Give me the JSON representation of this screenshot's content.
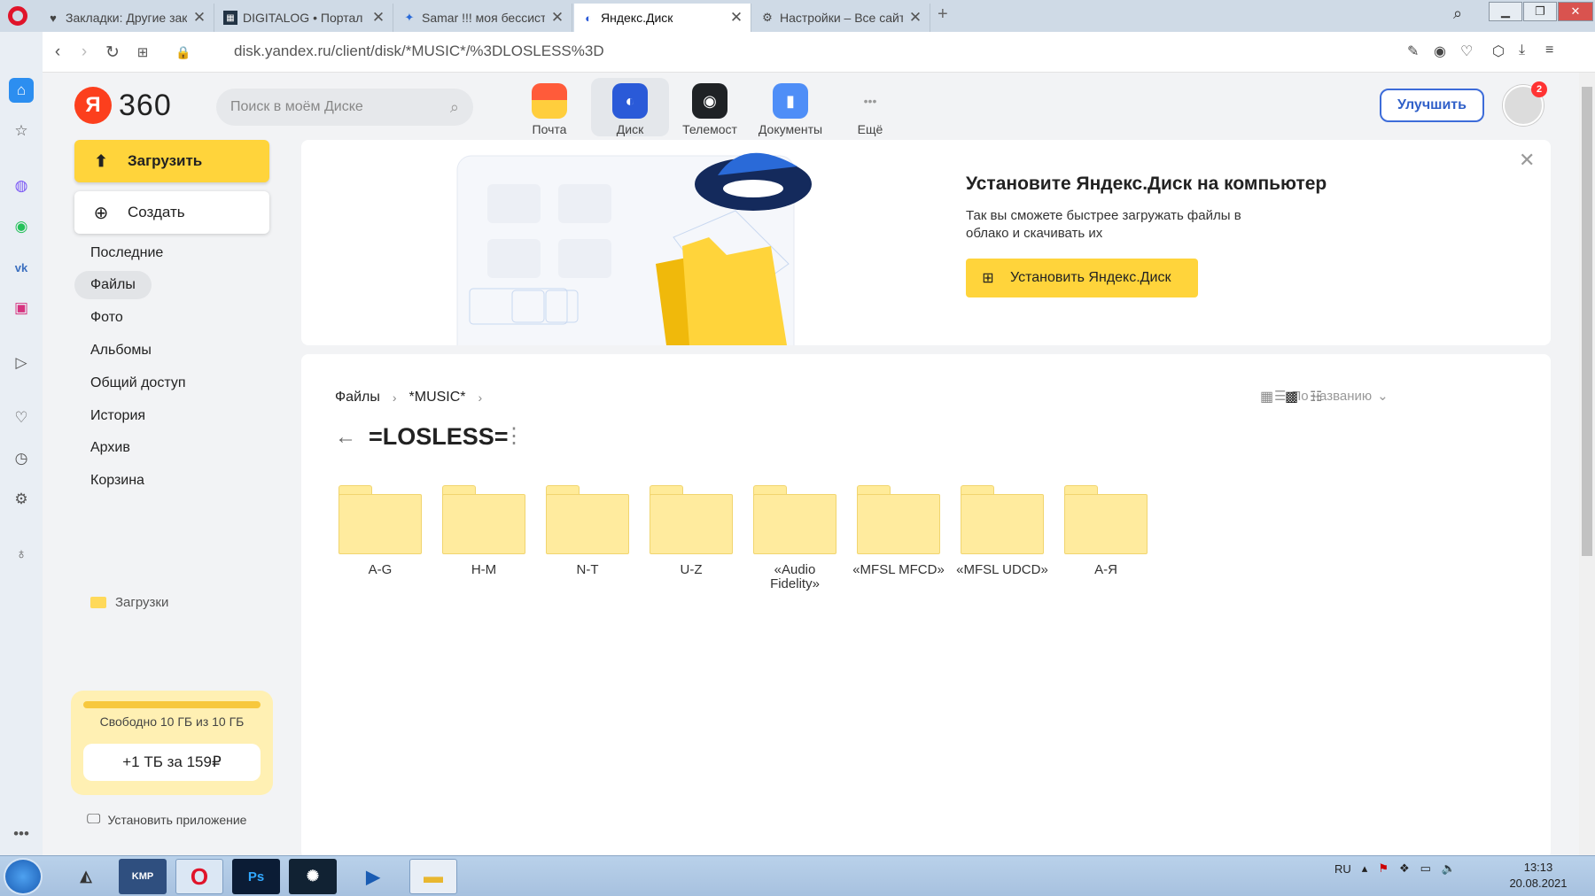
{
  "browser": {
    "tabs": [
      {
        "icon": "heart-icon",
        "title": "Закладки: Другие закладк",
        "active": false
      },
      {
        "icon": "digitalog-icon",
        "title": "DIGITALOG • Портал",
        "active": false
      },
      {
        "icon": "waveform-icon",
        "title": "Samar !!! моя бессистемн",
        "active": false
      },
      {
        "icon": "yandex-disk-icon",
        "title": "Яндекс.Диск",
        "active": true
      },
      {
        "icon": "gear-icon",
        "title": "Настройки – Все сайты",
        "active": false
      }
    ],
    "new_tab": "+",
    "url": "disk.yandex.ru/client/disk/*MUSIC*/%3DLOSLESS%3D"
  },
  "header": {
    "logo_letter": "Я",
    "logo_text": "360",
    "search_placeholder": "Поиск в моём Диске",
    "services": [
      {
        "name": "mail",
        "label": "Почта",
        "color": "#ffce3d"
      },
      {
        "name": "disk",
        "label": "Диск",
        "color": "#2a5ad8",
        "active": true
      },
      {
        "name": "telemost",
        "label": "Телемост",
        "color": "#1f2225"
      },
      {
        "name": "documents",
        "label": "Документы",
        "color": "#4f8ef7"
      },
      {
        "name": "more",
        "label": "Ещё"
      }
    ],
    "upgrade_label": "Улучшить",
    "notification_count": "2"
  },
  "sidebar": {
    "upload_label": "Загрузить",
    "create_label": "Создать",
    "nav": [
      {
        "label": "Последние",
        "active": false
      },
      {
        "label": "Файлы",
        "active": true
      },
      {
        "label": "Фото",
        "active": false
      },
      {
        "label": "Альбомы",
        "active": false
      },
      {
        "label": "Общий доступ",
        "active": false
      },
      {
        "label": "История",
        "active": false
      },
      {
        "label": "Архив",
        "active": false
      },
      {
        "label": "Корзина",
        "active": false
      }
    ],
    "downloads_label": "Загрузки",
    "storage_text": "Свободно 10 ГБ из 10 ГБ",
    "storage_used_fraction": 0.0,
    "storage_button": "+1 ТБ за 159₽",
    "install_app": "Установить приложение"
  },
  "promo": {
    "title": "Установите Яндекс.Диск на компьютер",
    "text": "Так вы сможете быстрее загружать файлы в облако и скачивать их",
    "button": "Установить Яндекс.Диск"
  },
  "files": {
    "breadcrumbs": [
      "Файлы",
      "*MUSIC*"
    ],
    "title": "=LOSLESS=",
    "sort_label": "По названию",
    "folders": [
      "A-G",
      "H-M",
      "N-T",
      "U-Z",
      "«Audio Fidelity»",
      "«MFSL MFCD»",
      "«MFSL UDCD»",
      "А-Я"
    ]
  },
  "taskbar": {
    "apps": [
      {
        "name": "taskbar-app-fox",
        "label": ""
      },
      {
        "name": "taskbar-app-kmplayer",
        "label": "KMP"
      },
      {
        "name": "taskbar-app-opera",
        "label": "O"
      },
      {
        "name": "taskbar-app-photoshop",
        "label": "Ps"
      },
      {
        "name": "taskbar-app-fan",
        "label": ""
      },
      {
        "name": "taskbar-app-media",
        "label": "▶"
      },
      {
        "name": "taskbar-app-explorer",
        "label": ""
      }
    ],
    "lang": "RU",
    "time": "13:13",
    "date": "20.08.2021"
  }
}
